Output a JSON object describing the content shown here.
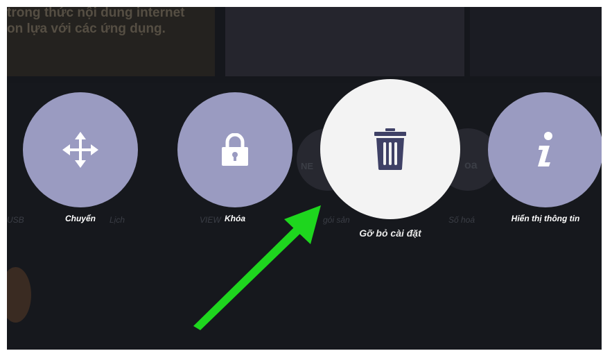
{
  "background": {
    "headline": "trong thức nội dung internet\non lựa với các ứng dụng.",
    "ghost_labels": [
      "USB",
      "Lịch",
      "VIEW",
      "gói sản",
      "Số hoá",
      "oa",
      "NE"
    ]
  },
  "menu": {
    "items": [
      {
        "label": "Chuyển",
        "icon": "move-arrows-icon",
        "selected": false
      },
      {
        "label": "Khóa",
        "icon": "lock-icon",
        "selected": false
      },
      {
        "label": "Gỡ bỏ cài đặt",
        "icon": "trash-icon",
        "selected": true
      },
      {
        "label": "Hiển thị thông tin",
        "icon": "info-icon",
        "selected": false
      }
    ]
  },
  "colors": {
    "screen": "#15171c",
    "circle": "#9a9bc1",
    "circle_selected": "#f3f3f3",
    "icon_selected": "#3f4166",
    "arrow": "#1ed61e"
  }
}
